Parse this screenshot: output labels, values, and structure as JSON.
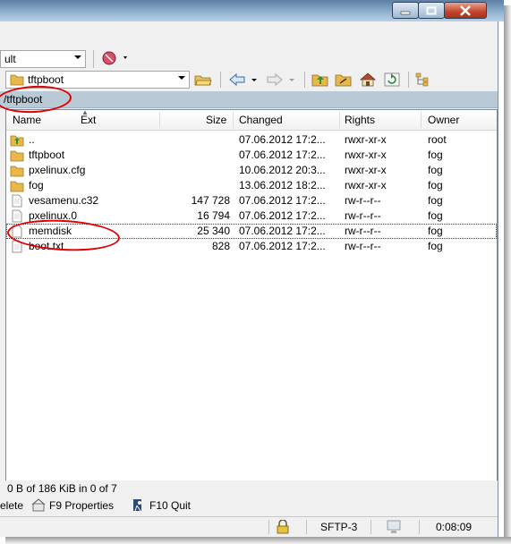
{
  "toolbar": {
    "session_combo": "ult",
    "path_combo": "tftpboot"
  },
  "path_bar": {
    "path": "/tftpboot"
  },
  "columns": {
    "name": "Name",
    "ext": "Ext",
    "size": "Size",
    "changed": "Changed",
    "rights": "Rights",
    "owner": "Owner"
  },
  "files": [
    {
      "icon": "up-folder-icon",
      "name": "..",
      "size": "",
      "changed": "07.06.2012 17:2...",
      "rights": "rwxr-xr-x",
      "owner": "root"
    },
    {
      "icon": "folder-icon",
      "name": "tftpboot",
      "size": "",
      "changed": "07.06.2012 17:2...",
      "rights": "rwxr-xr-x",
      "owner": "fog"
    },
    {
      "icon": "folder-icon",
      "name": "pxelinux.cfg",
      "size": "",
      "changed": "10.06.2012 20:3...",
      "rights": "rwxr-xr-x",
      "owner": "fog"
    },
    {
      "icon": "folder-icon",
      "name": "fog",
      "size": "",
      "changed": "13.06.2012 18:2...",
      "rights": "rwxr-xr-x",
      "owner": "fog"
    },
    {
      "icon": "file-icon",
      "name": "vesamenu.c32",
      "size": "147 728",
      "changed": "07.06.2012 17:2...",
      "rights": "rw-r--r--",
      "owner": "fog"
    },
    {
      "icon": "file-icon",
      "name": "pxelinux.0",
      "size": "16 794",
      "changed": "07.06.2012 17:2...",
      "rights": "rw-r--r--",
      "owner": "fog"
    },
    {
      "icon": "file-icon",
      "name": "memdisk",
      "size": "25 340",
      "changed": "07.06.2012 17:2...",
      "rights": "rw-r--r--",
      "owner": "fog"
    },
    {
      "icon": "file-icon",
      "name": "boot.txt",
      "size": "828",
      "changed": "07.06.2012 17:2...",
      "rights": "rw-r--r--",
      "owner": "fog"
    }
  ],
  "status": {
    "text": "0 B of 186 KiB in 0 of 7"
  },
  "fkeys": {
    "delete": "elete",
    "properties": "F9 Properties",
    "quit": "F10 Quit"
  },
  "bottom": {
    "protocol": "SFTP-3",
    "elapsed": "0:08:09"
  },
  "colors": {
    "annotation": "#e00000",
    "path_bar": "#b9c9d6",
    "folder": "#e8b84a"
  }
}
